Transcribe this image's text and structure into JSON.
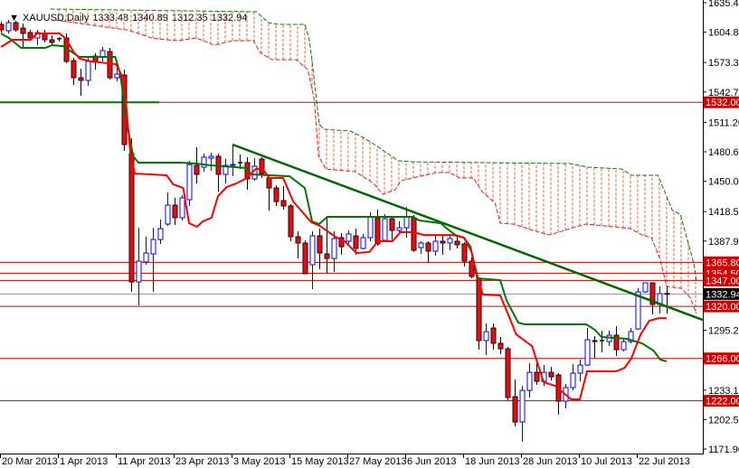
{
  "header": {
    "arrow": "▼",
    "symbol": "XAUUSD,Daily",
    "open": "1333.48",
    "high": "1340.89",
    "low": "1312.35",
    "close": "1332.94"
  },
  "colors": {
    "bull": "#0000ff",
    "bear": "#e01010",
    "tenkan": "#ff0000",
    "kijun": "#007700",
    "trendline": "#006600",
    "level": "#d00000",
    "bid": "#8a96a6",
    "cloud": "#e8602a",
    "spanA": "#dd2222",
    "spanB": "#117711"
  },
  "chart_data": {
    "type": "candlestick",
    "title": "XAUUSD,Daily",
    "ylim": [
      1171.9,
      1635.4
    ],
    "y_ticks": [
      "1635.40",
      "1604.80",
      "1573.30",
      "1542.70",
      "1511.20",
      "1480.60",
      "1450.00",
      "1418.50",
      "1387.90",
      "1295.20",
      "1233.10",
      "1202.50",
      "1171.90"
    ],
    "x_ticks": [
      {
        "bar": 0,
        "label": "20 Mar 2013"
      },
      {
        "bar": 8,
        "label": "1 Apr 2013"
      },
      {
        "bar": 16,
        "label": "11 Apr 2013"
      },
      {
        "bar": 24,
        "label": "23 Apr 2013"
      },
      {
        "bar": 32,
        "label": "3 May 2013"
      },
      {
        "bar": 40,
        "label": "15 May 2013"
      },
      {
        "bar": 48,
        "label": "27 May 2013"
      },
      {
        "bar": 56,
        "label": "6 Jun 2013"
      },
      {
        "bar": 64,
        "label": "18 Jun 2013"
      },
      {
        "bar": 72,
        "label": "28 Jun 2013"
      },
      {
        "bar": 80,
        "label": "10 Jul 2013"
      },
      {
        "bar": 88,
        "label": "22 Jul 2013"
      }
    ],
    "ohlc": [
      [
        1612.9,
        1615.7,
        1604.4,
        1607.2
      ],
      [
        1606.3,
        1617.6,
        1603.5,
        1614.7
      ],
      [
        1614.7,
        1616.6,
        1605.3,
        1607.2
      ],
      [
        1609.1,
        1613.8,
        1588.5,
        1603.5
      ],
      [
        1604.4,
        1607.2,
        1596.0,
        1598.8
      ],
      [
        1598.8,
        1607.2,
        1591.3,
        1604.4
      ],
      [
        1603.5,
        1607.2,
        1594.1,
        1596.9
      ],
      [
        1596.9,
        1601.6,
        1591.3,
        1594.1
      ],
      [
        1597.9,
        1599.7,
        1595.0,
        1598.0
      ],
      [
        1598.8,
        1603.5,
        1572.5,
        1574.4
      ],
      [
        1575.3,
        1578.1,
        1550.0,
        1557.5
      ],
      [
        1557.5,
        1566.9,
        1538.7,
        1554.7
      ],
      [
        1554.7,
        1579.1,
        1549.1,
        1574.4
      ],
      [
        1580.0,
        1582.8,
        1565.9,
        1574.4
      ],
      [
        1579.1,
        1589.4,
        1574.4,
        1585.7
      ],
      [
        1584.7,
        1588.5,
        1555.6,
        1557.5
      ],
      [
        1557.5,
        1569.7,
        1553.8,
        1561.3
      ],
      [
        1560.3,
        1565.9,
        1481.5,
        1488.1
      ],
      [
        1478.7,
        1494.6,
        1335.1,
        1345.4
      ],
      [
        1345.4,
        1401.7,
        1321.1,
        1367.0
      ],
      [
        1366.1,
        1392.4,
        1363.3,
        1375.5
      ],
      [
        1374.5,
        1401.7,
        1335.1,
        1389.5
      ],
      [
        1389.5,
        1410.2,
        1384.9,
        1400.8
      ],
      [
        1405.5,
        1438.3,
        1403.6,
        1425.2
      ],
      [
        1425.2,
        1432.7,
        1404.6,
        1412.1
      ],
      [
        1412.1,
        1435.5,
        1409.3,
        1432.7
      ],
      [
        1430.8,
        1471.2,
        1424.3,
        1467.4
      ],
      [
        1466.5,
        1485.3,
        1447.7,
        1457.1
      ],
      [
        1464.6,
        1478.7,
        1459.9,
        1475.0
      ],
      [
        1474.0,
        1479.6,
        1460.9,
        1475.9
      ],
      [
        1475.9,
        1478.7,
        1439.3,
        1457.1
      ],
      [
        1457.1,
        1473.1,
        1447.7,
        1466.5
      ],
      [
        1466.5,
        1488.1,
        1455.2,
        1467.4
      ],
      [
        1469.3,
        1477.8,
        1462.7,
        1469.3
      ],
      [
        1469.3,
        1475.0,
        1441.2,
        1452.4
      ],
      [
        1452.4,
        1474.0,
        1450.5,
        1465.6
      ],
      [
        1473.1,
        1475.0,
        1453.4,
        1458.0
      ],
      [
        1453.4,
        1457.1,
        1419.6,
        1443.0
      ],
      [
        1443.0,
        1445.8,
        1424.3,
        1428.9
      ],
      [
        1429.9,
        1444.9,
        1420.5,
        1424.3
      ],
      [
        1424.3,
        1426.1,
        1387.7,
        1392.4
      ],
      [
        1392.4,
        1398.0,
        1369.8,
        1385.8
      ],
      [
        1385.8,
        1388.6,
        1353.9,
        1353.9
      ],
      [
        1363.3,
        1398.0,
        1337.9,
        1393.3
      ],
      [
        1393.3,
        1400.8,
        1358.6,
        1375.5
      ],
      [
        1374.5,
        1414.0,
        1353.9,
        1369.8
      ],
      [
        1369.8,
        1398.0,
        1355.8,
        1390.5
      ],
      [
        1391.4,
        1396.1,
        1373.6,
        1382.0
      ],
      [
        1387.7,
        1398.9,
        1384.9,
        1395.2
      ],
      [
        1393.3,
        1400.8,
        1373.6,
        1380.2
      ],
      [
        1380.2,
        1395.2,
        1379.2,
        1391.4
      ],
      [
        1391.4,
        1417.7,
        1387.7,
        1413.0
      ],
      [
        1412.1,
        1420.5,
        1383.0,
        1384.9
      ],
      [
        1388.6,
        1415.8,
        1387.7,
        1411.1
      ],
      [
        1411.1,
        1413.0,
        1389.5,
        1398.9
      ],
      [
        1398.9,
        1408.3,
        1397.1,
        1401.7
      ],
      [
        1401.7,
        1423.3,
        1391.4,
        1413.0
      ],
      [
        1412.1,
        1414.9,
        1376.4,
        1378.3
      ],
      [
        1381.1,
        1387.7,
        1374.5,
        1385.8
      ],
      [
        1385.8,
        1387.7,
        1365.2,
        1377.4
      ],
      [
        1377.4,
        1394.2,
        1372.7,
        1387.7
      ],
      [
        1387.7,
        1394.2,
        1373.6,
        1385.8
      ],
      [
        1385.8,
        1394.2,
        1378.3,
        1390.5
      ],
      [
        1387.7,
        1392.4,
        1380.2,
        1384.0
      ],
      [
        1384.9,
        1386.8,
        1361.4,
        1367.0
      ],
      [
        1367.0,
        1370.8,
        1349.2,
        1351.1
      ],
      [
        1348.3,
        1350.1,
        1275.1,
        1284.5
      ],
      [
        1284.5,
        1302.3,
        1269.5,
        1293.8
      ],
      [
        1297.6,
        1302.3,
        1275.1,
        1281.7
      ],
      [
        1281.7,
        1288.2,
        1270.4,
        1276.0
      ],
      [
        1276.0,
        1277.9,
        1222.5,
        1225.4
      ],
      [
        1226.3,
        1244.1,
        1195.3,
        1200.0
      ],
      [
        1200.0,
        1237.5,
        1179.4,
        1232.8
      ],
      [
        1232.8,
        1261.0,
        1225.4,
        1251.6
      ],
      [
        1251.6,
        1261.0,
        1238.5,
        1242.2
      ],
      [
        1242.2,
        1259.1,
        1237.5,
        1251.6
      ],
      [
        1251.6,
        1257.2,
        1243.2,
        1246.9
      ],
      [
        1248.8,
        1250.7,
        1207.5,
        1221.6
      ],
      [
        1221.6,
        1239.4,
        1214.1,
        1235.7
      ],
      [
        1235.7,
        1260.1,
        1232.8,
        1250.7
      ],
      [
        1250.7,
        1264.8,
        1242.2,
        1259.1
      ],
      [
        1259.1,
        1297.6,
        1258.2,
        1285.4
      ],
      [
        1284.5,
        1289.2,
        1266.6,
        1283.5
      ],
      [
        1284.5,
        1294.8,
        1272.3,
        1284.5
      ],
      [
        1283.5,
        1294.8,
        1278.9,
        1290.1
      ],
      [
        1290.1,
        1299.5,
        1268.5,
        1275.1
      ],
      [
        1275.1,
        1286.4,
        1273.2,
        1283.5
      ],
      [
        1283.5,
        1297.6,
        1281.7,
        1293.8
      ],
      [
        1296.6,
        1338.9,
        1295.7,
        1335.1
      ],
      [
        1335.1,
        1344.5,
        1334.2,
        1344.5
      ],
      [
        1344.5,
        1344.5,
        1311.7,
        1322.0
      ],
      [
        1322.0,
        1340.8,
        1312.6,
        1333.3
      ],
      [
        1333.48,
        1340.89,
        1312.35,
        1332.94
      ]
    ],
    "tenkan": [
      [
        0,
        1589.4
      ],
      [
        1.6,
        1596.9
      ],
      [
        4.1,
        1596.9
      ],
      [
        5,
        1603.5
      ],
      [
        8.1,
        1603.5
      ],
      [
        9,
        1597.9
      ],
      [
        10,
        1584.7
      ],
      [
        10.9,
        1577.2
      ],
      [
        12.5,
        1574.4
      ],
      [
        15.9,
        1571.6
      ],
      [
        16.6,
        1561.3
      ],
      [
        17.1,
        1547.2
      ],
      [
        17.9,
        1478.7
      ],
      [
        18.5,
        1458.0
      ],
      [
        22.9,
        1456.2
      ],
      [
        23.8,
        1446.8
      ],
      [
        25.2,
        1443.0
      ],
      [
        26,
        1406.4
      ],
      [
        27.1,
        1402.7
      ],
      [
        27.9,
        1408.3
      ],
      [
        29.1,
        1412.1
      ],
      [
        30,
        1434.6
      ],
      [
        31.2,
        1444.0
      ],
      [
        32.5,
        1447.7
      ],
      [
        34,
        1453.4
      ],
      [
        35.2,
        1462.7
      ],
      [
        36.2,
        1462.7
      ],
      [
        37.1,
        1453.4
      ],
      [
        39,
        1453.4
      ],
      [
        40.4,
        1428.9
      ],
      [
        42.9,
        1407.4
      ],
      [
        44.1,
        1403.6
      ],
      [
        46.2,
        1392.4
      ],
      [
        47.5,
        1387.7
      ],
      [
        49.1,
        1375.5
      ],
      [
        50.9,
        1376.4
      ],
      [
        52.1,
        1387.7
      ],
      [
        54.1,
        1387.7
      ],
      [
        55.2,
        1397.1
      ],
      [
        57.1,
        1397.1
      ],
      [
        58.4,
        1394.2
      ],
      [
        62.5,
        1394.2
      ],
      [
        64,
        1391.4
      ],
      [
        65,
        1377.4
      ],
      [
        65.9,
        1350.1
      ],
      [
        66.6,
        1332.3
      ],
      [
        69,
        1331.4
      ],
      [
        70.2,
        1309.8
      ],
      [
        71.2,
        1291.0
      ],
      [
        73.4,
        1278.8
      ],
      [
        75,
        1241.3
      ],
      [
        76.6,
        1237.5
      ],
      [
        78.8,
        1223.5
      ],
      [
        80,
        1223.5
      ],
      [
        81,
        1252.6
      ],
      [
        85,
        1252.6
      ],
      [
        86.2,
        1256.3
      ],
      [
        87.1,
        1265.7
      ],
      [
        88.4,
        1291.0
      ],
      [
        89.6,
        1305.1
      ],
      [
        90.9,
        1307.9
      ],
      [
        92,
        1307.9
      ]
    ],
    "kijun": [
      [
        0,
        1603.5
      ],
      [
        1.1,
        1598.8
      ],
      [
        2.8,
        1588.5
      ],
      [
        6.1,
        1588.5
      ],
      [
        7.1,
        1591.3
      ],
      [
        8.6,
        1590.3
      ],
      [
        10.8,
        1579.1
      ],
      [
        15.8,
        1579.1
      ],
      [
        16.5,
        1561.3
      ],
      [
        17.4,
        1509.7
      ],
      [
        18.3,
        1475.9
      ],
      [
        19,
        1469.3
      ],
      [
        24.9,
        1469.3
      ],
      [
        27,
        1468.4
      ],
      [
        29,
        1466.5
      ],
      [
        34,
        1463.7
      ],
      [
        34.6,
        1457.1
      ],
      [
        39.9,
        1455.2
      ],
      [
        42,
        1443.0
      ],
      [
        43,
        1408.3
      ],
      [
        44,
        1405.5
      ],
      [
        45.1,
        1413.0
      ],
      [
        57,
        1413.0
      ],
      [
        57.8,
        1409.3
      ],
      [
        60.8,
        1406.4
      ],
      [
        61.5,
        1401.7
      ],
      [
        62.8,
        1394.2
      ],
      [
        64,
        1391.4
      ],
      [
        64.9,
        1382.0
      ],
      [
        65.8,
        1349.2
      ],
      [
        69,
        1347.3
      ],
      [
        69.9,
        1325.8
      ],
      [
        71.5,
        1303.2
      ],
      [
        72.4,
        1301.4
      ],
      [
        80.9,
        1301.4
      ],
      [
        82.1,
        1295.7
      ],
      [
        83,
        1288.2
      ],
      [
        86.5,
        1286.4
      ],
      [
        88.6,
        1281.7
      ],
      [
        90.2,
        1274.1
      ],
      [
        91.1,
        1264.8
      ],
      [
        92,
        1262.9
      ]
    ],
    "span_a": [
      [
        7.4,
        1617.6
      ],
      [
        17.4,
        1607.2
      ],
      [
        19,
        1603.5
      ],
      [
        20.8,
        1598.8
      ],
      [
        22.8,
        1596.9
      ],
      [
        24.5,
        1596.0
      ],
      [
        27,
        1598.8
      ],
      [
        29.5,
        1591.3
      ],
      [
        32,
        1596.0
      ],
      [
        34.9,
        1596.0
      ],
      [
        35.8,
        1583.8
      ],
      [
        37.4,
        1576.3
      ],
      [
        40.8,
        1576.3
      ],
      [
        42.4,
        1566.0
      ],
      [
        43.3,
        1535.0
      ],
      [
        43.9,
        1475.9
      ],
      [
        44.9,
        1462.7
      ],
      [
        49,
        1459.9
      ],
      [
        51.5,
        1447.7
      ],
      [
        52.8,
        1436.5
      ],
      [
        54.5,
        1441.2
      ],
      [
        55.3,
        1450.5
      ],
      [
        57.4,
        1454.3
      ],
      [
        60.3,
        1459.0
      ],
      [
        62,
        1459.0
      ],
      [
        63.4,
        1453.4
      ],
      [
        65.3,
        1453.4
      ],
      [
        66.5,
        1439.3
      ],
      [
        68.3,
        1427.1
      ],
      [
        69,
        1406.4
      ],
      [
        70.8,
        1405.5
      ],
      [
        73.6,
        1398.9
      ],
      [
        75.8,
        1394.2
      ],
      [
        77.8,
        1398.9
      ],
      [
        80.8,
        1405.5
      ],
      [
        83.6,
        1403.6
      ],
      [
        87,
        1400.8
      ],
      [
        88.6,
        1394.2
      ],
      [
        89.9,
        1391.4
      ],
      [
        91.1,
        1368.9
      ],
      [
        92,
        1340.8
      ],
      [
        94,
        1338.9
      ],
      [
        95.3,
        1328.6
      ],
      [
        96.1,
        1312.8
      ]
    ],
    "span_b": [
      [
        6.8,
        1628.8
      ],
      [
        35.3,
        1626.0
      ],
      [
        37,
        1614.7
      ],
      [
        38.3,
        1612.9
      ],
      [
        42,
        1612.9
      ],
      [
        42.6,
        1597.9
      ],
      [
        43,
        1575.3
      ],
      [
        43.6,
        1535.0
      ],
      [
        44,
        1509.7
      ],
      [
        44.6,
        1504.0
      ],
      [
        48.3,
        1502.2
      ],
      [
        50.3,
        1494.6
      ],
      [
        52,
        1486.2
      ],
      [
        54.9,
        1471.2
      ],
      [
        57,
        1470.2
      ],
      [
        78.6,
        1468.4
      ],
      [
        81.1,
        1464.6
      ],
      [
        85.8,
        1462.7
      ],
      [
        87.1,
        1456.2
      ],
      [
        90.8,
        1456.2
      ],
      [
        92.8,
        1419.6
      ],
      [
        93.9,
        1415.8
      ],
      [
        95.8,
        1363.3
      ],
      [
        96.1,
        1347.3
      ]
    ],
    "trendline": [
      [
        32,
        1488.1
      ],
      [
        97,
        1306.0
      ]
    ],
    "green_level_segment": {
      "price": 1532.0,
      "from_bar": 0,
      "to_bar": 21.9
    },
    "levels": [
      {
        "price": 1532.0,
        "label": "1532.00"
      },
      {
        "price": 1365.8,
        "label": "1365.80"
      },
      {
        "price": 1354.5,
        "label": "1354.50"
      },
      {
        "price": 1347.0,
        "label": "1347.00"
      },
      {
        "price": 1320.0,
        "label": "1320.00"
      },
      {
        "price": 1266.0,
        "label": "1266.00"
      },
      {
        "price": 1222.0,
        "label": "1222.00"
      }
    ],
    "bid": {
      "price": 1332.94,
      "label": "1332.94"
    }
  }
}
